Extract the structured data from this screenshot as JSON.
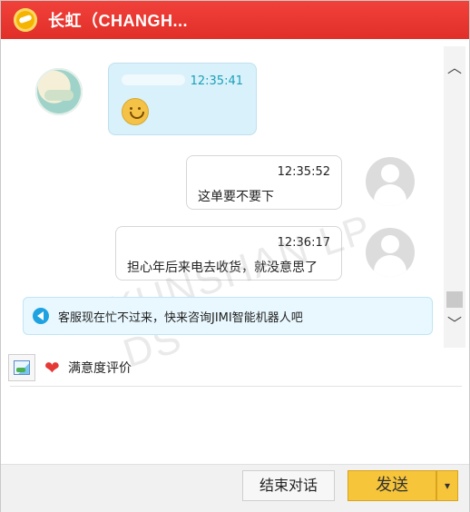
{
  "window": {
    "title": "长虹（CHANGH..."
  },
  "messages": [
    {
      "time": "12:35:41",
      "text": ""
    },
    {
      "time": "12:35:52",
      "text": "这单要不要下"
    },
    {
      "time": "12:36:17",
      "text": "担心年后来电去收货，就没意思了"
    }
  ],
  "notice": {
    "text": "客服现在忙不过来，快来咨询JIMI智能机器人吧"
  },
  "watermark": {
    "text": "KUNSHAN LP DS"
  },
  "toolbar": {
    "rating_label": "满意度评价"
  },
  "buttons": {
    "end_chat": "结束对话",
    "send": "发送",
    "send_dropdown": "▾"
  },
  "scrollbar": {
    "up": "︿",
    "down": "﹀"
  },
  "icons": {
    "logo": "logo-icon",
    "smiley": "smiley-icon",
    "speaker": "speaker-icon",
    "image": "image-icon",
    "heart": "heart-icon",
    "chevron_down": "chevron-down-icon"
  },
  "colors": {
    "title_bar": "#e12f28",
    "send_button": "#f7c53a",
    "notice_bg": "#e9f8ff",
    "bot_bubble": "#d9f1fb"
  }
}
